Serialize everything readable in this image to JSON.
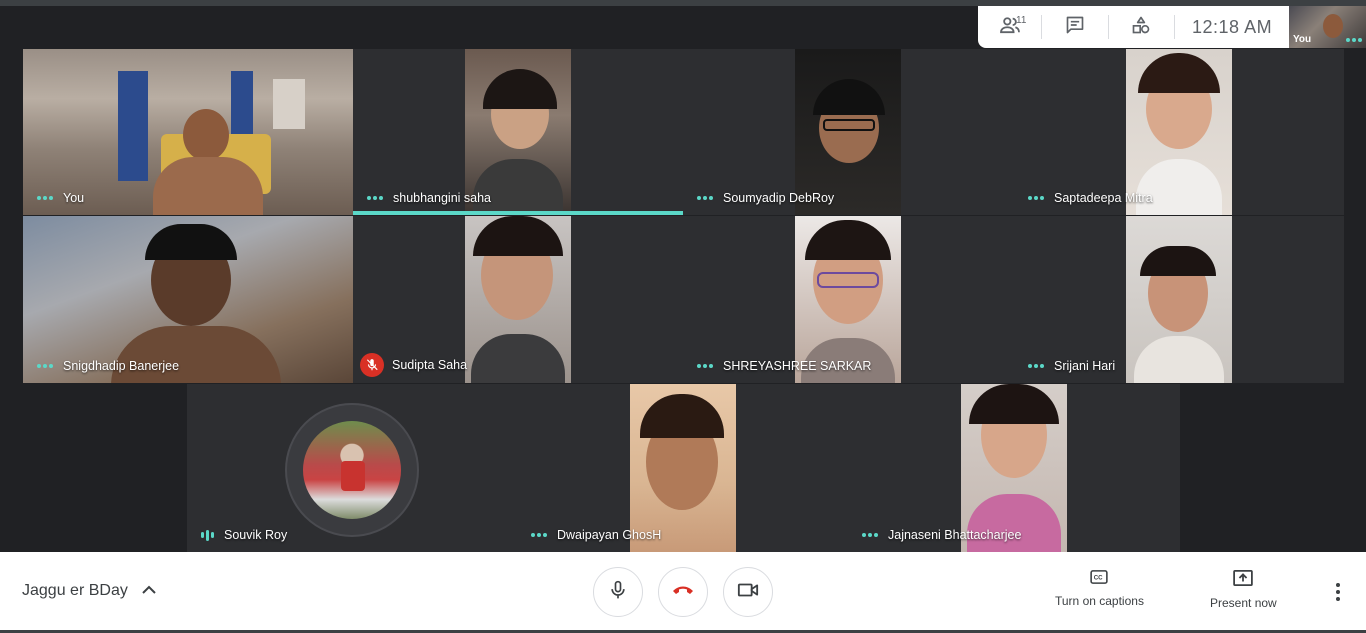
{
  "topbar": {
    "participants_count": "11",
    "time": "12:18  AM",
    "self_preview_label": "You"
  },
  "participants": [
    {
      "name": "You",
      "status": "active"
    },
    {
      "name": "shubhangini saha",
      "status": "speaking"
    },
    {
      "name": "Soumyadip DebRoy",
      "status": "active"
    },
    {
      "name": "Saptadeepa Mitra",
      "status": "active"
    },
    {
      "name": "Snigdhadip Banerjee",
      "status": "active"
    },
    {
      "name": "Sudipta Saha",
      "status": "muted"
    },
    {
      "name": "SHREYASHREE SARKAR",
      "status": "active"
    },
    {
      "name": "Srijani Hari",
      "status": "active"
    },
    {
      "name": "Souvik Roy",
      "status": "audio"
    },
    {
      "name": "Dwaipayan GhosH",
      "status": "active"
    },
    {
      "name": "Jajnaseni Bhattacharjee",
      "status": "active"
    }
  ],
  "bottombar": {
    "meeting_title": "Jaggu er BDay",
    "captions_label": "Turn on captions",
    "present_label": "Present now"
  },
  "colors": {
    "accent": "#5bd8c8",
    "background": "#202124",
    "tile": "#2d2e31",
    "hangup": "#d93025"
  }
}
